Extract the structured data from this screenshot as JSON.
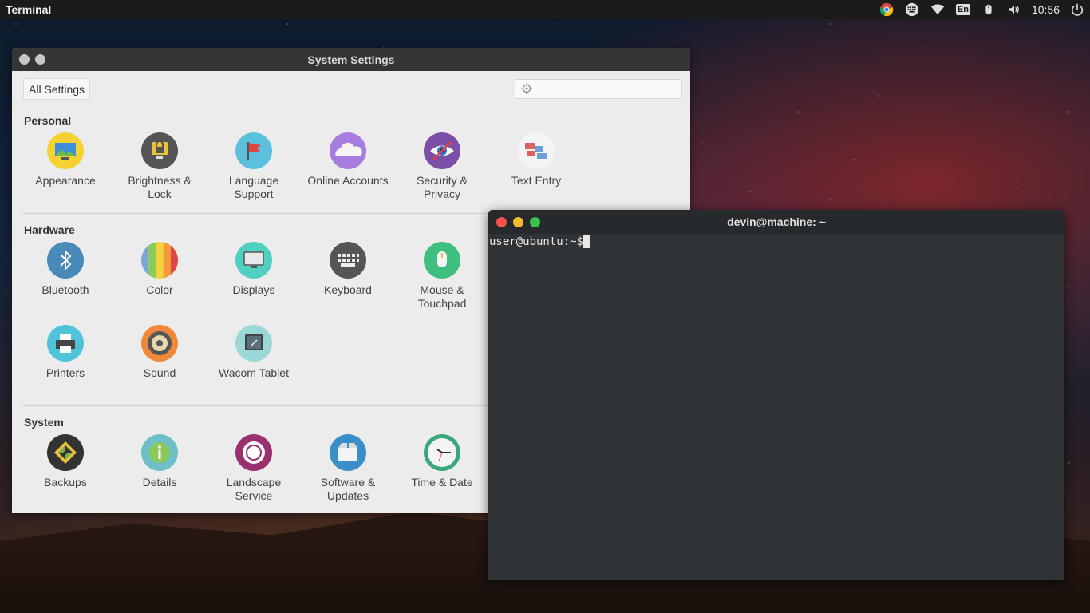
{
  "panel": {
    "app_name": "Terminal",
    "clock": "10:56",
    "lang": "En",
    "indicators": [
      "chrome-icon",
      "keyboard-icon",
      "wifi-icon",
      "lang-icon",
      "mouse-icon",
      "volume-icon",
      "power-icon"
    ]
  },
  "settings": {
    "title": "System Settings",
    "all_settings": "All Settings",
    "search_placeholder": "",
    "sections": [
      {
        "title": "Personal",
        "items": [
          {
            "label": "Appearance",
            "icon": "appearance-icon"
          },
          {
            "label": "Brightness & Lock",
            "icon": "brightness-lock-icon"
          },
          {
            "label": "Language Support",
            "icon": "language-icon"
          },
          {
            "label": "Online Accounts",
            "icon": "online-accounts-icon"
          },
          {
            "label": "Security & Privacy",
            "icon": "security-icon"
          },
          {
            "label": "Text Entry",
            "icon": "text-entry-icon"
          }
        ]
      },
      {
        "title": "Hardware",
        "items": [
          {
            "label": "Bluetooth",
            "icon": "bluetooth-icon"
          },
          {
            "label": "Color",
            "icon": "color-icon"
          },
          {
            "label": "Displays",
            "icon": "displays-icon"
          },
          {
            "label": "Keyboard",
            "icon": "keyboard-icon"
          },
          {
            "label": "Mouse & Touchpad",
            "icon": "mouse-icon"
          },
          {
            "label": "Printers",
            "icon": "printer-icon"
          },
          {
            "label": "Sound",
            "icon": "sound-icon"
          },
          {
            "label": "Wacom Tablet",
            "icon": "tablet-icon"
          }
        ]
      },
      {
        "title": "System",
        "items": [
          {
            "label": "Backups",
            "icon": "backups-icon"
          },
          {
            "label": "Details",
            "icon": "details-icon"
          },
          {
            "label": "Landscape Service",
            "icon": "landscape-icon"
          },
          {
            "label": "Software & Updates",
            "icon": "software-icon"
          },
          {
            "label": "Time & Date",
            "icon": "clock-icon"
          }
        ]
      }
    ]
  },
  "terminal": {
    "title": "devin@machine: ~",
    "prompt": "user@ubuntu:~$"
  }
}
